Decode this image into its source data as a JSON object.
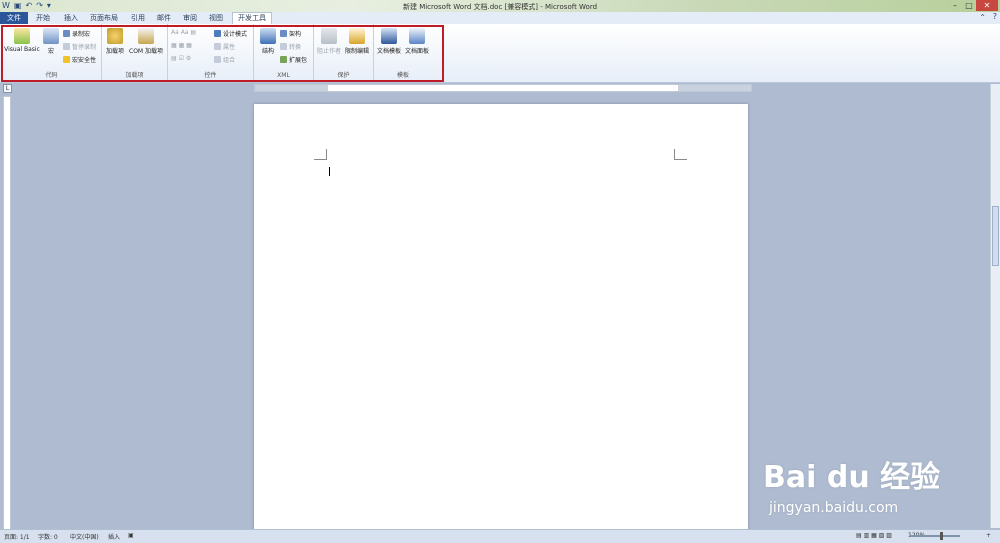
{
  "window": {
    "title": "新建 Microsoft Word 文档.doc [兼容模式] - Microsoft Word"
  },
  "tabs": [
    "文件",
    "开始",
    "插入",
    "页面布局",
    "引用",
    "邮件",
    "审阅",
    "视图",
    "开发工具"
  ],
  "active_tab": "开发工具",
  "ribbon": {
    "code": {
      "label": "代码",
      "visual_basic": "Visual Basic",
      "macros": "宏",
      "record": "录制宏",
      "pause": "暂停录制",
      "security": "宏安全性"
    },
    "addins": {
      "label": "加载项",
      "addins": "加载项",
      "com": "COM 加载项"
    },
    "controls": {
      "label": "控件",
      "design_mode": "设计模式",
      "properties": "属性",
      "group": "组合"
    },
    "xml": {
      "label": "XML",
      "structure": "结构",
      "schema": "架构",
      "transform": "转换",
      "expansion": "扩展包"
    },
    "protect": {
      "label": "保护",
      "block_authors": "阻止作者",
      "restrict": "限制编辑"
    },
    "templates": {
      "label": "模板",
      "doc_template": "文档模板",
      "doc_panel": "文档面板"
    }
  },
  "status": {
    "page": "页面: 1/1",
    "words": "字数: 0",
    "language": "中文(中国)",
    "mode": "插入",
    "zoom": "120%"
  },
  "watermark": {
    "brand": "Bai du 经验",
    "url": "jingyan.baidu.com"
  },
  "colors": {
    "highlight_box": "#c01c28",
    "file_tab": "#2b579a"
  }
}
